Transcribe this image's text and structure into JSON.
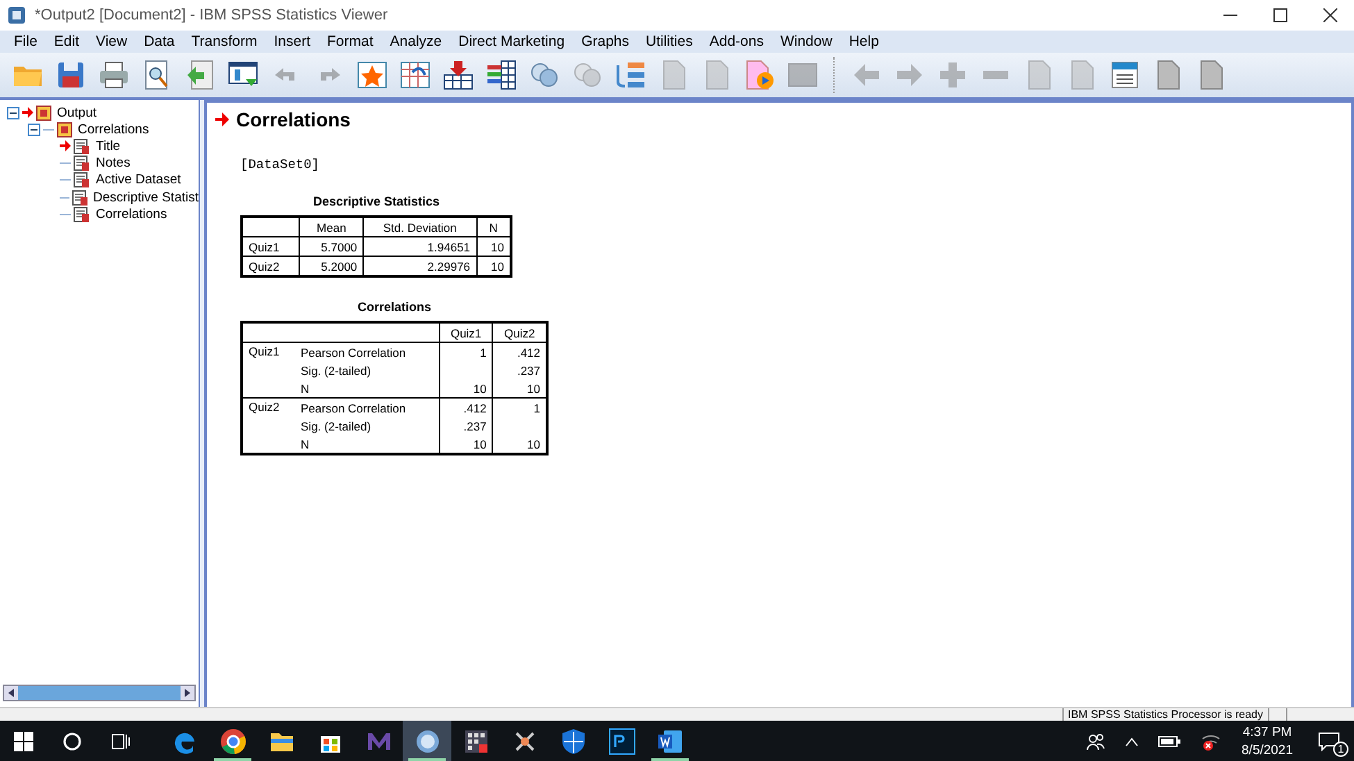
{
  "window": {
    "title": "*Output2 [Document2] - IBM SPSS Statistics Viewer"
  },
  "menu": [
    "File",
    "Edit",
    "View",
    "Data",
    "Transform",
    "Insert",
    "Format",
    "Analyze",
    "Direct Marketing",
    "Graphs",
    "Utilities",
    "Add-ons",
    "Window",
    "Help"
  ],
  "toolbar": [
    [
      {
        "kind": "folder",
        "disabled": false
      },
      {
        "kind": "save",
        "disabled": false
      },
      {
        "kind": "print",
        "disabled": false
      },
      {
        "kind": "preview",
        "disabled": false
      },
      {
        "kind": "export",
        "disabled": false
      },
      {
        "kind": "dialog",
        "disabled": false
      },
      {
        "kind": "undo",
        "disabled": true
      },
      {
        "kind": "redo",
        "disabled": true
      },
      {
        "kind": "star",
        "disabled": false
      },
      {
        "kind": "pivot",
        "disabled": false
      },
      {
        "kind": "download",
        "disabled": false
      },
      {
        "kind": "bars",
        "disabled": false
      },
      {
        "kind": "circles",
        "disabled": false
      },
      {
        "kind": "circles",
        "disabled": true
      },
      {
        "kind": "tree",
        "disabled": false
      },
      {
        "kind": "doc",
        "disabled": true
      },
      {
        "kind": "doc",
        "disabled": true
      },
      {
        "kind": "play",
        "disabled": false
      },
      {
        "kind": "square",
        "disabled": true
      }
    ],
    [
      {
        "kind": "left",
        "disabled": true
      },
      {
        "kind": "right",
        "disabled": true
      },
      {
        "kind": "plus",
        "disabled": true
      },
      {
        "kind": "minus",
        "disabled": true
      },
      {
        "kind": "doc",
        "disabled": true
      },
      {
        "kind": "doc",
        "disabled": true
      },
      {
        "kind": "header",
        "disabled": false
      },
      {
        "kind": "doc",
        "disabled": false
      },
      {
        "kind": "doc",
        "disabled": false
      }
    ]
  ],
  "outline": [
    {
      "label": "Output",
      "expanded": true,
      "current": true,
      "children": [
        {
          "label": "Correlations",
          "expanded": true,
          "current": false,
          "children": [
            {
              "label": "Title",
              "current": true
            },
            {
              "label": "Notes",
              "current": false
            },
            {
              "label": "Active Dataset",
              "current": false
            },
            {
              "label": "Descriptive Statist",
              "current": false
            },
            {
              "label": "Correlations",
              "current": false
            }
          ]
        }
      ]
    }
  ],
  "output": {
    "heading": "Correlations",
    "dataset": "[DataSet0]",
    "descriptives": {
      "title": "Descriptive Statistics",
      "columns": [
        "",
        "Mean",
        "Std. Deviation",
        "N"
      ],
      "rows": [
        [
          "Quiz1",
          "5.7000",
          "1.94651",
          "10"
        ],
        [
          "Quiz2",
          "5.2000",
          "2.29976",
          "10"
        ]
      ]
    },
    "correlations": {
      "title": "Correlations",
      "columns": [
        "",
        "",
        "Quiz1",
        "Quiz2"
      ],
      "groups": [
        {
          "name": "Quiz1",
          "rows": [
            {
              "label": "Pearson Correlation",
              "values": {
                "c1": "1",
                "c2": ".412"
              }
            },
            {
              "label": "Sig. (2-tailed)",
              "values": {
                "c2": ".237"
              }
            },
            {
              "label": "N",
              "values": {
                "c1": "10",
                "c2": "10"
              }
            }
          ]
        },
        {
          "name": "Quiz2",
          "rows": [
            {
              "label": "Pearson Correlation",
              "values": {
                "c1": ".412",
                "c2": "1"
              }
            },
            {
              "label": "Sig. (2-tailed)",
              "values": {
                "c1": ".237"
              }
            },
            {
              "label": "N",
              "values": {
                "c1": "10",
                "c2": "10"
              }
            }
          ]
        }
      ]
    }
  },
  "status_bar": "IBM SPSS Statistics Processor is ready",
  "taskbar": {
    "apps": [
      {
        "kind": "edge",
        "running": false,
        "active": false
      },
      {
        "kind": "chrome",
        "running": true,
        "active": false
      },
      {
        "kind": "folder",
        "running": false,
        "active": false
      },
      {
        "kind": "store",
        "running": false,
        "active": false
      },
      {
        "kind": "m",
        "running": false,
        "active": false
      },
      {
        "kind": "spss",
        "running": true,
        "active": true
      },
      {
        "kind": "grid",
        "running": false,
        "active": false
      },
      {
        "kind": "tool",
        "running": false,
        "active": false
      },
      {
        "kind": "shield",
        "running": false,
        "active": false
      },
      {
        "kind": "ps",
        "running": false,
        "active": false
      },
      {
        "kind": "word",
        "running": true,
        "active": false
      }
    ],
    "time": "4:37 PM",
    "date": "8/5/2021",
    "notifications": "1"
  }
}
